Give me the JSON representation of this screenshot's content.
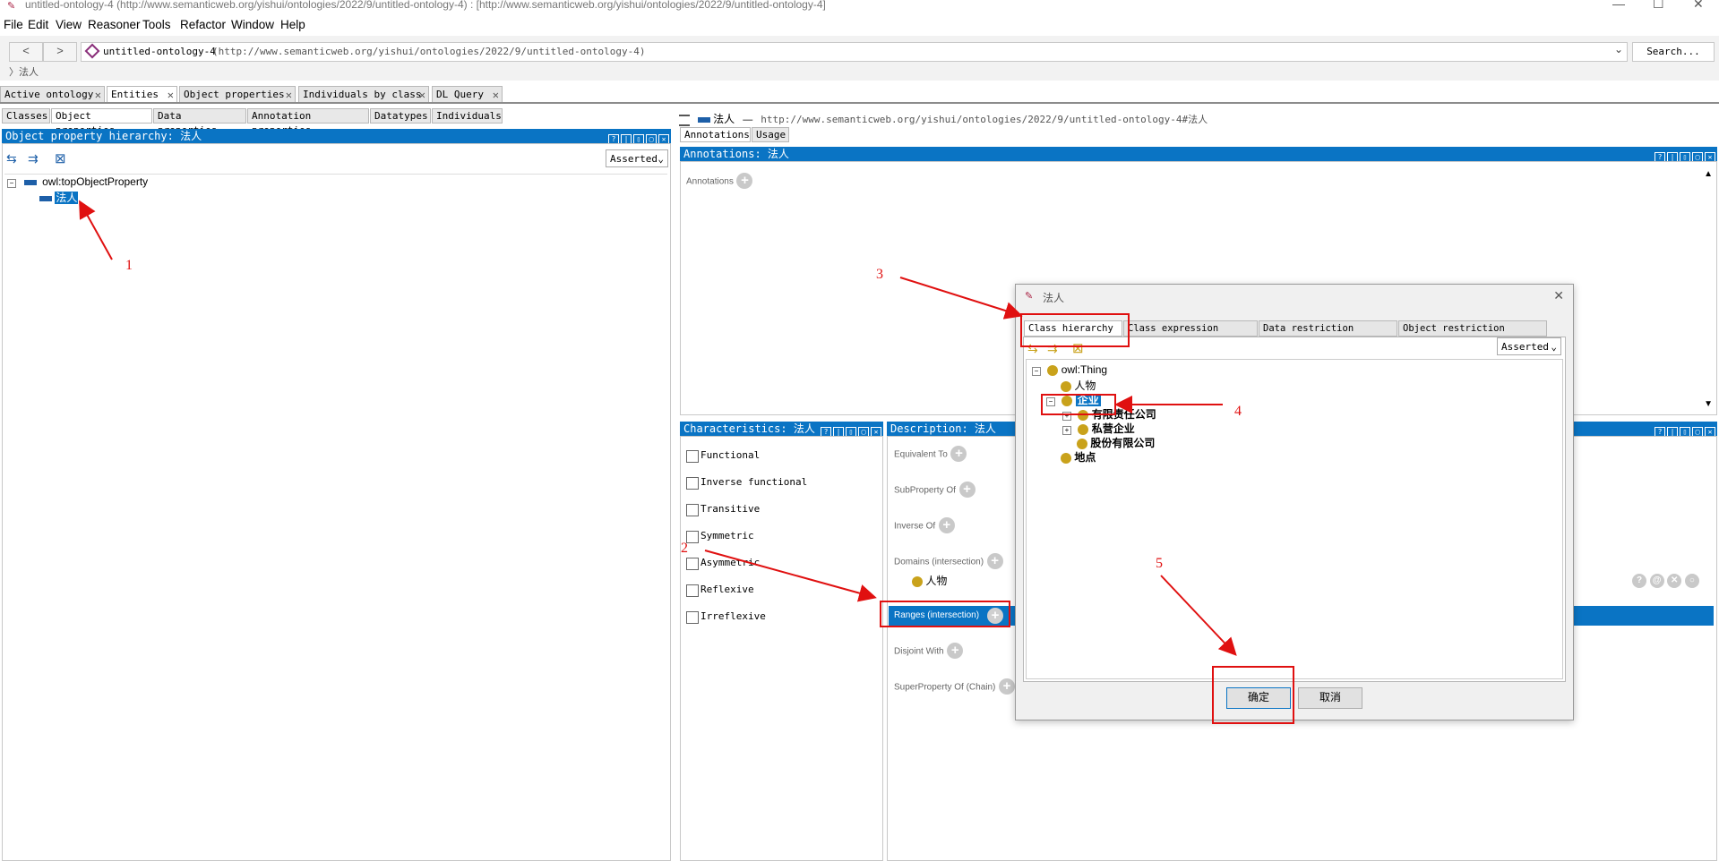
{
  "window": {
    "title": "untitled-ontology-4 (http://www.semanticweb.org/yishui/ontologies/2022/9/untitled-ontology-4) : [http://www.semanticweb.org/yishui/ontologies/2022/9/untitled-ontology-4]"
  },
  "menu": [
    "File",
    "Edit",
    "View",
    "Reasoner",
    "Tools",
    "Refactor",
    "Window",
    "Help"
  ],
  "nav": {
    "back": "<",
    "forward": ">",
    "ontology_name": "untitled-ontology-4",
    "ontology_iri": "(http://www.semanticweb.org/yishui/ontologies/2022/9/untitled-ontology-4)",
    "search": "Search...",
    "breadcrumb": "〉法人"
  },
  "main_tabs": [
    "Active ontology",
    "Entities",
    "Object properties",
    "Individuals by class",
    "DL Query"
  ],
  "entity_tabs": [
    "Classes",
    "Object properties",
    "Data properties",
    "Annotation properties",
    "Datatypes",
    "Individuals"
  ],
  "hierarchy": {
    "header": "Object property hierarchy: 法人",
    "mode": "Asserted",
    "root": "owl:topObjectProperty",
    "child": "法人"
  },
  "entity": {
    "name": "法人",
    "separator": "—",
    "iri": "http://www.semanticweb.org/yishui/ontologies/2022/9/untitled-ontology-4#法人",
    "tabs": [
      "Annotations",
      "Usage"
    ]
  },
  "annotations": {
    "header": "Annotations: 法人",
    "label": "Annotations"
  },
  "characteristics": {
    "header": "Characteristics: 法人",
    "items": [
      "Functional",
      "Inverse functional",
      "Transitive",
      "Symmetric",
      "Asymmetric",
      "Reflexive",
      "Irreflexive"
    ]
  },
  "description": {
    "header": "Description: 法人",
    "sections": [
      "Equivalent To",
      "SubProperty Of",
      "Inverse Of",
      "Domains (intersection)",
      "Ranges (intersection)",
      "Disjoint With",
      "SuperProperty Of (Chain)"
    ],
    "domain_value": "人物"
  },
  "dialog": {
    "title": "法人",
    "tabs": [
      "Class hierarchy",
      "Class expression editor",
      "Data restriction creator",
      "Object restriction creator"
    ],
    "mode": "Asserted",
    "tree": {
      "root": "owl:Thing",
      "c1": "人物",
      "c2": "企业",
      "c2a": "有限责任公司",
      "c2b": "私营企业",
      "c2c": "股份有限公司",
      "c3": "地点"
    },
    "ok": "确定",
    "cancel": "取消"
  },
  "annotation_marks": [
    "1",
    "2",
    "3",
    "4",
    "5"
  ],
  "colors": {
    "accent": "#0a74c4",
    "annotation": "#e01010",
    "class": "#c9a21b",
    "property": "#1d5fa8"
  }
}
